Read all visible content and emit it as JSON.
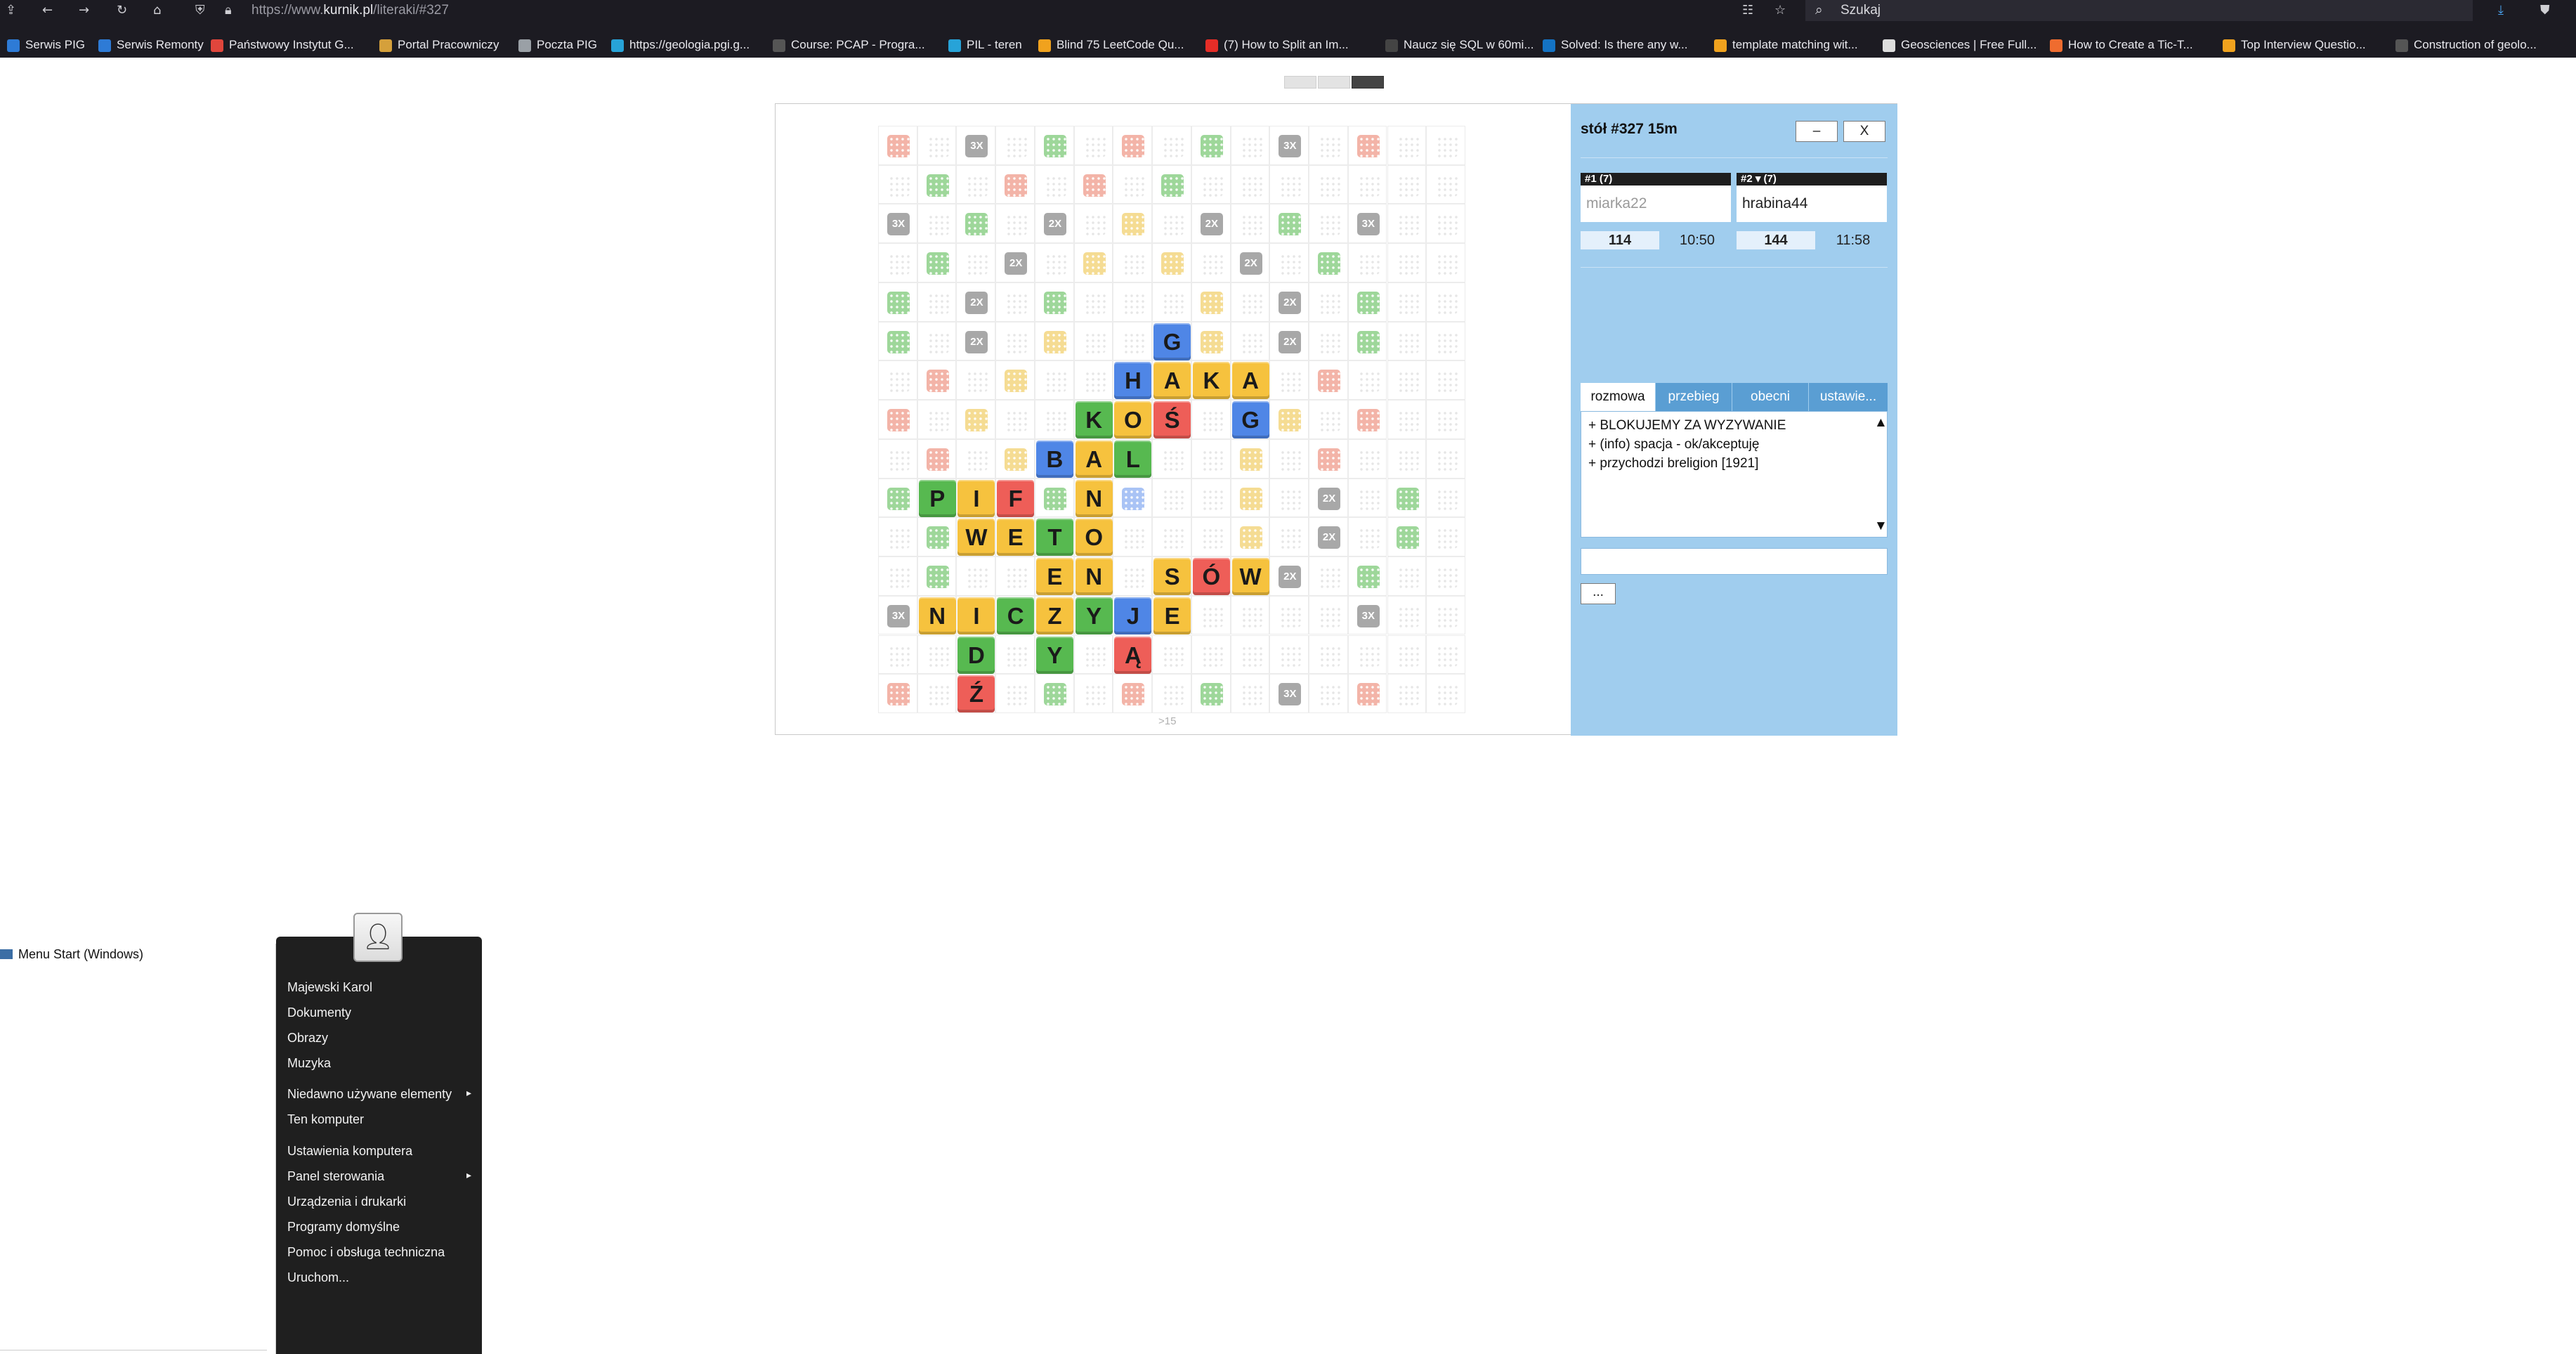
{
  "browser": {
    "url_prefix": "https://www.",
    "url_domain": "kurnik.pl",
    "url_path": "/literaki/#327",
    "search_placeholder": "Szukaj",
    "bookmarks": [
      {
        "label": "Serwis PIG",
        "color": "#2e7bd6"
      },
      {
        "label": "Serwis Remonty",
        "color": "#2e7bd6"
      },
      {
        "label": "Państwowy Instytut G...",
        "color": "#e0463c"
      },
      {
        "label": "Portal Pracowniczy",
        "color": "#d5a03b"
      },
      {
        "label": "Poczta PIG",
        "color": "#9aa0a6"
      },
      {
        "label": "https://geologia.pgi.g...",
        "color": "#27a3d8"
      },
      {
        "label": "Course: PCAP - Progra...",
        "color": "#555555"
      },
      {
        "label": "PIL - teren",
        "color": "#27a3d8"
      },
      {
        "label": "Blind 75 LeetCode Qu...",
        "color": "#f0a21e"
      },
      {
        "label": "(7) How to Split an Im...",
        "color": "#e52d27"
      },
      {
        "label": "Naucz się SQL w 60mi...",
        "color": "#444444"
      },
      {
        "label": "Solved: Is there any w...",
        "color": "#1473c4"
      },
      {
        "label": "template matching wit...",
        "color": "#f0a21e"
      },
      {
        "label": "Geosciences | Free Full...",
        "color": "#dddddd"
      },
      {
        "label": "How to Create a Tic-T...",
        "color": "#ef6c2f"
      },
      {
        "label": "Top Interview Questio...",
        "color": "#f0a21e"
      },
      {
        "label": "Construction of geolo...",
        "color": "#555555"
      }
    ]
  },
  "game": {
    "table_title": "stół #327   15m",
    "minimize_label": "–",
    "close_label": "X",
    "board_footer": ">15",
    "players": [
      {
        "header": "#1    (7)",
        "name": "miarka22",
        "score": "114",
        "time": "10:50"
      },
      {
        "header": "#2 ▾ (7)",
        "name": "hrabina44",
        "score": "144",
        "time": "11:58"
      }
    ],
    "tabs": [
      "rozmowa",
      "przebieg",
      "obecni",
      "ustawie..."
    ],
    "chat_lines": [
      "+ BLOKUJEMY ZA WYZYWANIE",
      "+ (info) spacja - ok/akceptuję",
      "+ przychodzi breligion [1921]"
    ],
    "more_label": "...",
    "colors": {
      "red": "#ee5e58",
      "yellow": "#f6c23e",
      "green": "#57b950",
      "blue": "#4f86e6",
      "gray": "#a8a8a8"
    },
    "premium_colors": {
      "r": "#f3b4a8",
      "y": "#f5dc93",
      "g": "#9ed79a",
      "b": "#a9c3f5"
    },
    "premium_rows": [
      "r.3.g.r.g.3.r",
      ".g.r.r.g.....",
      "3.g.2.y.2.g.3",
      ".g.2.y.y.2.g.",
      "g.2.g...y.2.g",
      "g.2.y...y.2.g",
      ".r.y.......r.",
      "r.y.......y.r",
      ".r.y.b...y.r.",
      "g...g.b..y.2.g",
      ".g.......y.2.g",
      ".g.....y..2.g",
      "3...........3",
      ".............",
      "r...g.r.g.3.r"
    ],
    "tiles": [
      {
        "r": 5,
        "c": 7,
        "l": "G",
        "k": "blue"
      },
      {
        "r": 6,
        "c": 6,
        "l": "H",
        "k": "blue"
      },
      {
        "r": 6,
        "c": 7,
        "l": "A",
        "k": "yellow"
      },
      {
        "r": 6,
        "c": 8,
        "l": "K",
        "k": "yellow"
      },
      {
        "r": 6,
        "c": 9,
        "l": "A",
        "k": "yellow"
      },
      {
        "r": 7,
        "c": 5,
        "l": "K",
        "k": "green"
      },
      {
        "r": 7,
        "c": 6,
        "l": "O",
        "k": "yellow"
      },
      {
        "r": 7,
        "c": 7,
        "l": "Ś",
        "k": "red"
      },
      {
        "r": 7,
        "c": 9,
        "l": "G",
        "k": "blue"
      },
      {
        "r": 8,
        "c": 4,
        "l": "B",
        "k": "blue"
      },
      {
        "r": 8,
        "c": 5,
        "l": "A",
        "k": "yellow"
      },
      {
        "r": 8,
        "c": 6,
        "l": "L",
        "k": "green"
      },
      {
        "r": 9,
        "c": 1,
        "l": "P",
        "k": "green"
      },
      {
        "r": 9,
        "c": 2,
        "l": "I",
        "k": "yellow"
      },
      {
        "r": 9,
        "c": 3,
        "l": "F",
        "k": "red"
      },
      {
        "r": 9,
        "c": 5,
        "l": "N",
        "k": "yellow"
      },
      {
        "r": 10,
        "c": 2,
        "l": "W",
        "k": "yellow"
      },
      {
        "r": 10,
        "c": 3,
        "l": "E",
        "k": "yellow"
      },
      {
        "r": 10,
        "c": 4,
        "l": "T",
        "k": "green"
      },
      {
        "r": 10,
        "c": 5,
        "l": "O",
        "k": "yellow"
      },
      {
        "r": 11,
        "c": 4,
        "l": "E",
        "k": "yellow"
      },
      {
        "r": 11,
        "c": 5,
        "l": "N",
        "k": "yellow"
      },
      {
        "r": 11,
        "c": 7,
        "l": "S",
        "k": "yellow"
      },
      {
        "r": 11,
        "c": 8,
        "l": "Ó",
        "k": "red"
      },
      {
        "r": 11,
        "c": 9,
        "l": "W",
        "k": "yellow"
      },
      {
        "r": 12,
        "c": 1,
        "l": "N",
        "k": "yellow"
      },
      {
        "r": 12,
        "c": 2,
        "l": "I",
        "k": "yellow"
      },
      {
        "r": 12,
        "c": 3,
        "l": "C",
        "k": "green"
      },
      {
        "r": 12,
        "c": 4,
        "l": "Z",
        "k": "yellow"
      },
      {
        "r": 12,
        "c": 5,
        "l": "Y",
        "k": "green"
      },
      {
        "r": 12,
        "c": 6,
        "l": "J",
        "k": "blue"
      },
      {
        "r": 12,
        "c": 7,
        "l": "E",
        "k": "yellow"
      },
      {
        "r": 13,
        "c": 2,
        "l": "D",
        "k": "green"
      },
      {
        "r": 13,
        "c": 4,
        "l": "Y",
        "k": "green"
      },
      {
        "r": 13,
        "c": 6,
        "l": "Ą",
        "k": "red"
      },
      {
        "r": 14,
        "c": 2,
        "l": "Ź",
        "k": "red"
      }
    ]
  },
  "start_menu": {
    "left_item": "Menu Start (Windows)",
    "items": [
      {
        "label": "Majewski Karol",
        "arrow": ""
      },
      {
        "label": "Dokumenty",
        "arrow": ""
      },
      {
        "label": "Obrazy",
        "arrow": ""
      },
      {
        "label": "Muzyka",
        "arrow": ""
      },
      {
        "label": "Niedawno używane elementy",
        "arrow": "▸"
      },
      {
        "label": "Ten komputer",
        "arrow": ""
      },
      {
        "label": "Ustawienia komputera",
        "arrow": ""
      },
      {
        "label": "Panel sterowania",
        "arrow": "▸"
      },
      {
        "label": "Urządzenia i drukarki",
        "arrow": ""
      },
      {
        "label": "Programy domyślne",
        "arrow": ""
      },
      {
        "label": "Pomoc i obsługa techniczna",
        "arrow": ""
      },
      {
        "label": "Uruchom...",
        "arrow": ""
      }
    ]
  }
}
